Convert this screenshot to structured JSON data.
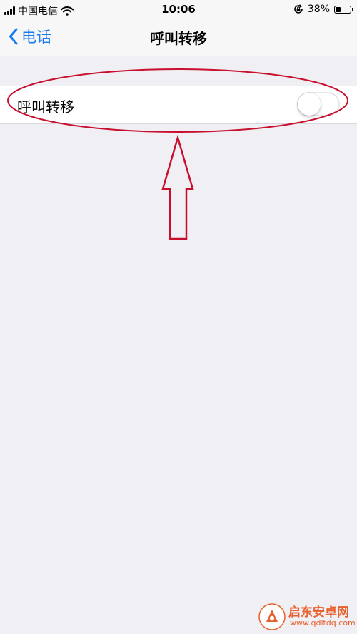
{
  "status_bar": {
    "carrier": "中国电信",
    "time": "10:06",
    "battery_percent": "38%",
    "battery_level": 0.38,
    "icons": [
      "signal-icon",
      "wifi-icon",
      "orientation-lock-icon",
      "battery-icon"
    ]
  },
  "nav": {
    "back_label": "电话",
    "title": "呼叫转移"
  },
  "settings": {
    "call_forwarding": {
      "label": "呼叫转移",
      "enabled": false
    }
  },
  "watermark": {
    "name": "启东安卓网",
    "url": "www.qdltdq.com"
  },
  "colors": {
    "accent": "#1a7cf2",
    "annotation": "#c8102e",
    "background": "#efeff4",
    "watermark": "#e8602c"
  }
}
